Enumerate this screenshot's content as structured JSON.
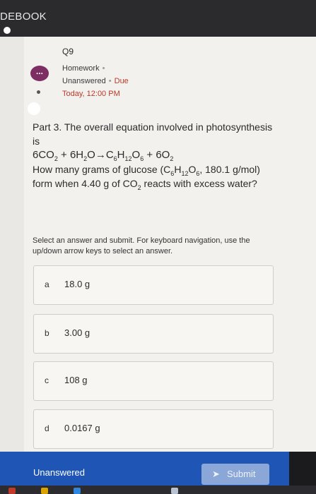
{
  "app": {
    "title": "DEBOOK"
  },
  "question": {
    "number": "Q9",
    "category": "Homework",
    "status": "Unanswered",
    "due_label": "Due",
    "due_time": "Today, 12:00 PM",
    "more_label": "..."
  },
  "problem": {
    "line1": "Part 3. The overall equation involved in photosynthesis is",
    "eq_6co2": "6CO",
    "eq_plus1": " + 6H",
    "eq_o_arrow": "O→C",
    "eq_h": "H",
    "eq_o6": "O",
    "eq_plus2": " + 6O",
    "sub_2": "2",
    "sub_6": "6",
    "sub_12": "12",
    "ask_part1": "How many grams of glucose (C",
    "ask_part2": "H",
    "ask_part3": "O",
    "ask_part4": ", 180.1 g/mol) form when 4.40 g of CO",
    "ask_part5": " reacts with excess water?"
  },
  "instruction": "Select an answer and submit. For keyboard navigation, use the up/down arrow keys to select an answer.",
  "options": [
    {
      "letter": "a",
      "text": "18.0 g"
    },
    {
      "letter": "b",
      "text": "3.00 g"
    },
    {
      "letter": "c",
      "text": "108 g"
    },
    {
      "letter": "d",
      "text": "0.0167 g"
    }
  ],
  "footer": {
    "status": "Unanswered",
    "submit_label": "Submit",
    "submit_icon": "send-icon"
  },
  "colors": {
    "accent": "#1f55b5",
    "due": "#b93a2a",
    "more_badge": "#7d2e62"
  }
}
